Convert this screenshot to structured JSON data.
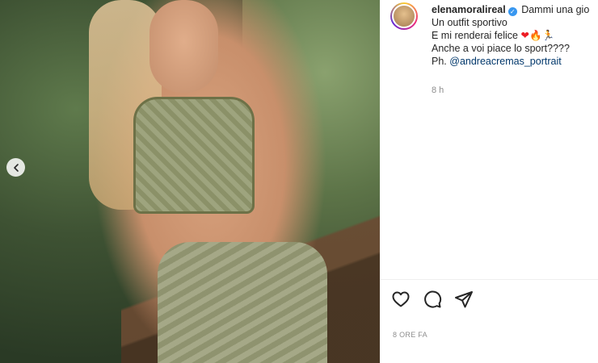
{
  "post": {
    "username": "elenamoralireal",
    "caption_start": "Dammi una gio",
    "caption_lines": [
      "Un outfit sportivo",
      "E mi renderai felice",
      "Anche a voi piace lo sport????"
    ],
    "emoji_line": [
      "❤",
      "🔥",
      "🏃"
    ],
    "photo_credit_prefix": "Ph. ",
    "photo_credit_mention": "@andreacremas_portrait",
    "comment_time": "8 h",
    "post_time": "8 ORE FA"
  },
  "icons": {
    "verified": "verified-badge-icon",
    "like": "heart-icon",
    "comment": "comment-icon",
    "share": "share-icon",
    "prev": "chevron-left-icon"
  },
  "colors": {
    "verified": "#3897f0",
    "mention": "#00376b",
    "muted": "#8e8e8e"
  }
}
